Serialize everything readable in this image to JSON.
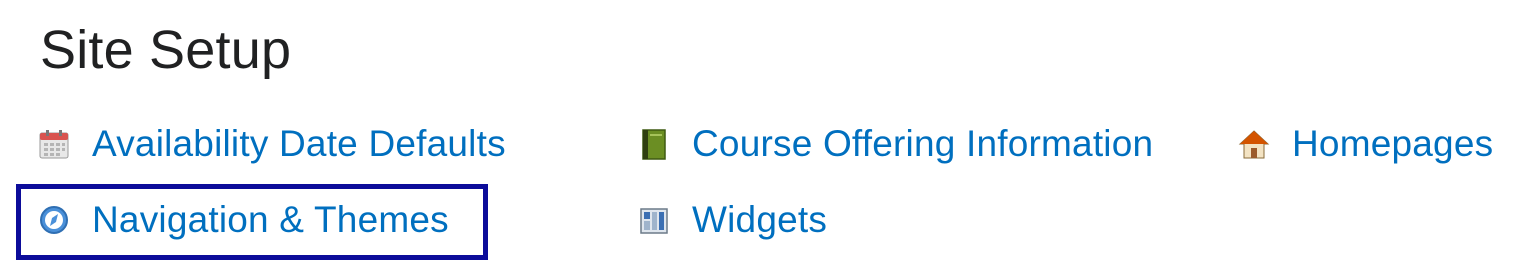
{
  "page": {
    "title": "Site Setup"
  },
  "links": {
    "availability": {
      "label": "Availability Date Defaults",
      "icon": "calendar-icon"
    },
    "course_offering": {
      "label": "Course Offering Information",
      "icon": "book-icon"
    },
    "homepages": {
      "label": "Homepages",
      "icon": "house-icon"
    },
    "navigation": {
      "label": "Navigation & Themes",
      "icon": "compass-icon"
    },
    "widgets": {
      "label": "Widgets",
      "icon": "widgets-grid-icon"
    }
  },
  "colors": {
    "link": "#006fbf",
    "title": "#202122",
    "highlight": "#0c0c9a"
  }
}
